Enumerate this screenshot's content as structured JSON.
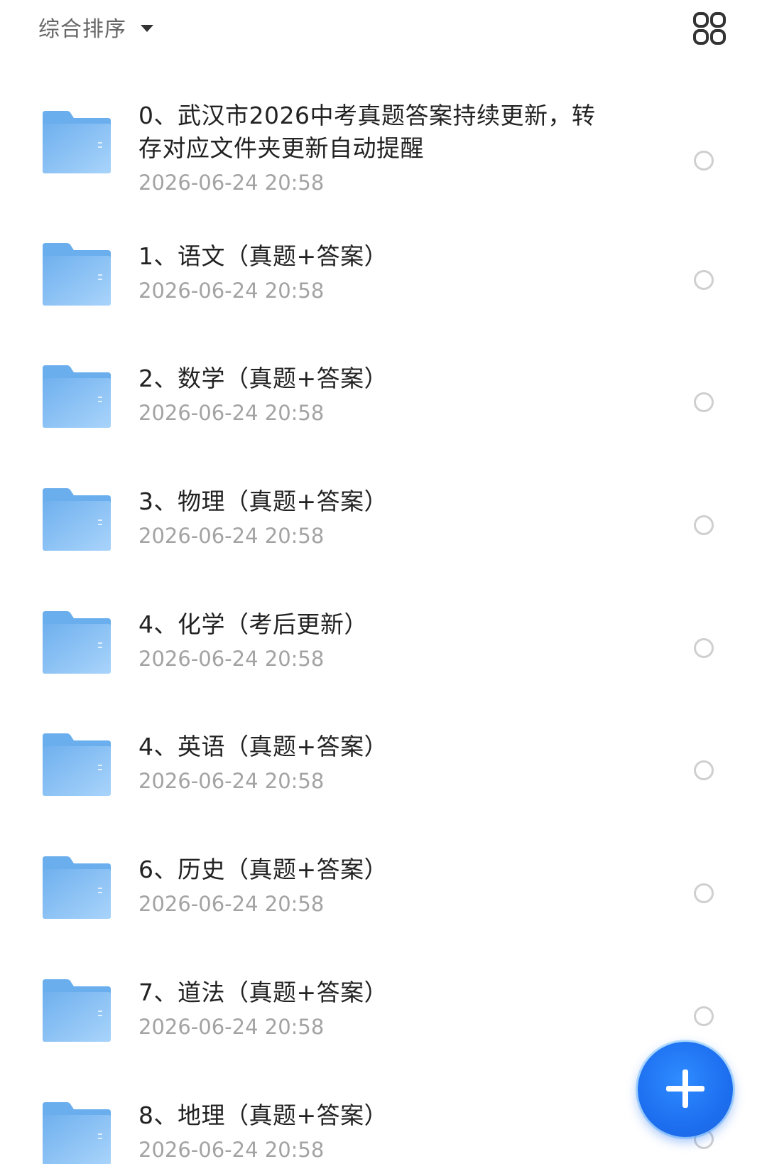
{
  "toolbar": {
    "sort_label": "综合排序",
    "sort_caret_icon": "caret-down-icon",
    "view_toggle_icon": "grid-view-icon"
  },
  "files": [
    {
      "title": "0、武汉市2026中考真题答案持续更新，转存对应文件夹更新自动提醒",
      "title_line1": "0、武汉市2026中考真题答案持续更新，转",
      "title_line2": "存对应文件夹更新自动提醒",
      "time": "2026-06-24 20:58",
      "icon": "folder-icon"
    },
    {
      "title": "1、语文（真题+答案）",
      "time": "2026-06-24 20:58",
      "icon": "folder-icon"
    },
    {
      "title": "2、数学（真题+答案）",
      "time": "2026-06-24 20:58",
      "icon": "folder-icon"
    },
    {
      "title": "3、物理（真题+答案）",
      "time": "2026-06-24 20:58",
      "icon": "folder-icon"
    },
    {
      "title": "4、化学（考后更新）",
      "time": "2026-06-24 20:58",
      "icon": "folder-icon"
    },
    {
      "title": "4、英语（真题+答案）",
      "time": "2026-06-24 20:58",
      "icon": "folder-icon"
    },
    {
      "title": "6、历史（真题+答案）",
      "time": "2026-06-24 20:58",
      "icon": "folder-icon"
    },
    {
      "title": "7、道法（真题+答案）",
      "time": "2026-06-24 20:58",
      "icon": "folder-icon"
    },
    {
      "title": "8、地理（真题+答案）",
      "time": "2026-06-24 20:58",
      "icon": "folder-icon"
    }
  ],
  "fab": {
    "icon": "plus-icon"
  },
  "colors": {
    "folder": "#7db9f0",
    "folder_light": "#a6d2fa",
    "accent": "#1d6ff0",
    "time_text": "#a3a3a3"
  }
}
